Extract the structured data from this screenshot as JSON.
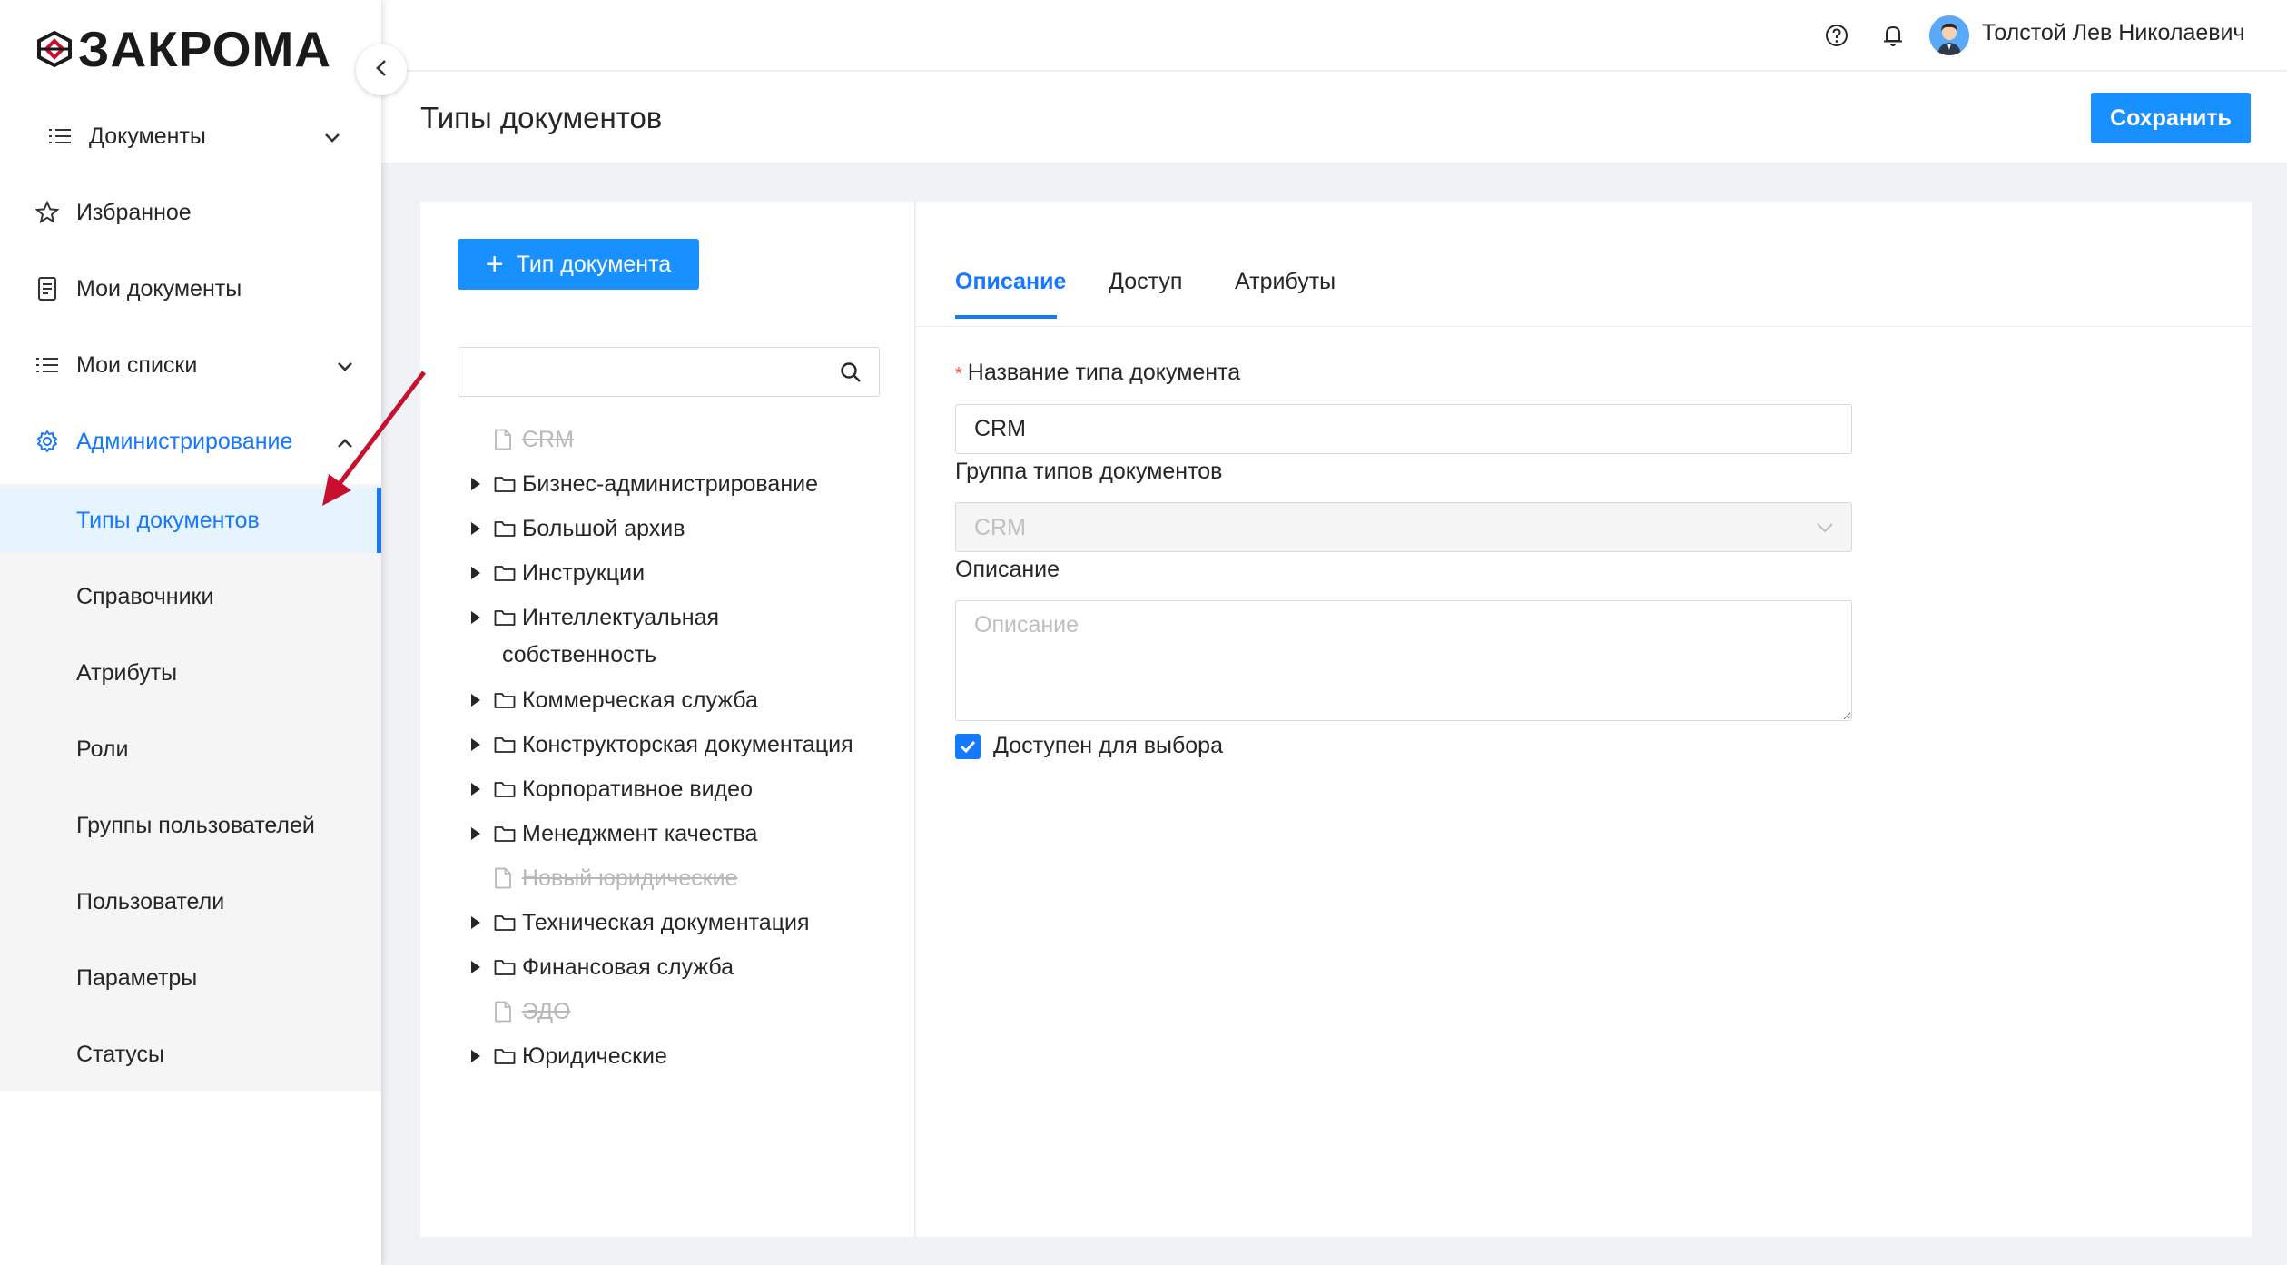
{
  "app": {
    "logo_text": "ЗАКРОМА"
  },
  "user": {
    "name": "Толстой Лев Николаевич"
  },
  "sidebar": {
    "items": [
      {
        "label": "Документы"
      },
      {
        "label": "Избранное"
      },
      {
        "label": "Мои документы"
      },
      {
        "label": "Мои списки"
      },
      {
        "label": "Администрирование"
      }
    ],
    "admin_submenu": [
      {
        "label": "Типы документов",
        "active": true
      },
      {
        "label": "Справочники"
      },
      {
        "label": "Атрибуты"
      },
      {
        "label": "Роли"
      },
      {
        "label": "Группы пользователей"
      },
      {
        "label": "Пользователи"
      },
      {
        "label": "Параметры"
      },
      {
        "label": "Статусы"
      }
    ]
  },
  "page": {
    "title": "Типы документов",
    "save_label": "Сохранить"
  },
  "left_panel": {
    "add_button_label": "Тип документа",
    "search_value": "",
    "tree": [
      {
        "label": "CRM",
        "deleted": true
      },
      {
        "label": "Бизнес-администрирование"
      },
      {
        "label": "Большой архив"
      },
      {
        "label": "Инструкции"
      },
      {
        "label": "Интеллектуальная",
        "label_cont": "собственность"
      },
      {
        "label": "Коммерческая служба"
      },
      {
        "label": "Конструкторская документация"
      },
      {
        "label": "Корпоративное видео"
      },
      {
        "label": "Менеджмент качества"
      },
      {
        "label": "Новый юридические",
        "deleted": true
      },
      {
        "label": "Техническая документация"
      },
      {
        "label": "Финансовая служба"
      },
      {
        "label": "ЭДО",
        "deleted": true
      },
      {
        "label": "Юридические"
      }
    ]
  },
  "tabs": [
    {
      "label": "Описание",
      "active": true
    },
    {
      "label": "Доступ"
    },
    {
      "label": "Атрибуты"
    }
  ],
  "form": {
    "name_label": "Название типа документа",
    "name_value": "CRM",
    "group_label": "Группа типов документов",
    "group_value": "CRM",
    "description_label": "Описание",
    "description_placeholder": "Описание",
    "available_label": "Доступен для выбора",
    "available_checked": true
  },
  "colors": {
    "accent": "#1677ff",
    "button": "#1890ff",
    "annotation_arrow": "#c8102e"
  }
}
